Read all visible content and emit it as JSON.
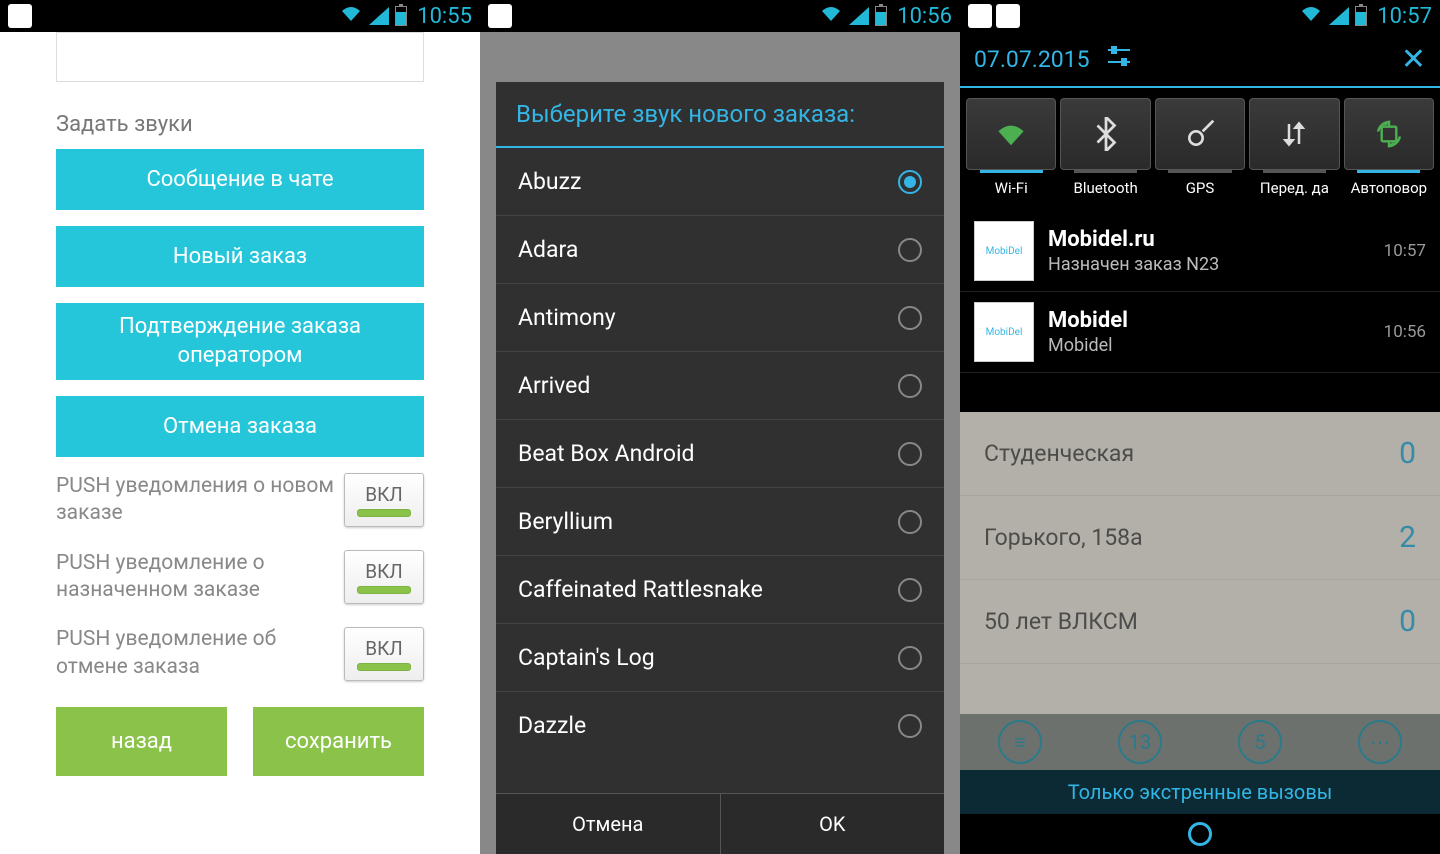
{
  "screen1": {
    "time": "10:55",
    "heading": "Задать звуки",
    "buttons": {
      "chat": "Сообщение в чате",
      "new_order": "Новый заказ",
      "confirm": "Подтверждение заказа оператором",
      "cancel": "Отмена заказа"
    },
    "push": {
      "new": "PUSH уведомления о новом заказе",
      "assigned": "PUSH уведомление о назначенном заказе",
      "cancel": "PUSH уведомление об отмене заказа",
      "toggle_label": "ВКЛ"
    },
    "footer": {
      "back": "назад",
      "save": "сохранить"
    }
  },
  "screen2": {
    "time": "10:56",
    "title": "Выберите звук нового заказа:",
    "items": [
      {
        "label": "Abuzz",
        "selected": true
      },
      {
        "label": "Adara",
        "selected": false
      },
      {
        "label": "Antimony",
        "selected": false
      },
      {
        "label": "Arrived",
        "selected": false
      },
      {
        "label": "Beat Box Android",
        "selected": false
      },
      {
        "label": "Beryllium",
        "selected": false
      },
      {
        "label": "Caffeinated Rattlesnake",
        "selected": false
      },
      {
        "label": "Captain's Log",
        "selected": false
      },
      {
        "label": "Dazzle",
        "selected": false
      }
    ],
    "footer": {
      "cancel": "Отмена",
      "ok": "OK"
    }
  },
  "screen3": {
    "time": "10:57",
    "date": "07.07.2015",
    "toggles": [
      {
        "label": "Wi-Fi",
        "active": true,
        "glyph": "wifi",
        "color": "green"
      },
      {
        "label": "Bluetooth",
        "active": false,
        "glyph": "bluetooth",
        "color": "white"
      },
      {
        "label": "GPS",
        "active": false,
        "glyph": "gps",
        "color": "white"
      },
      {
        "label": "Перед. да",
        "active": false,
        "glyph": "data",
        "color": "white"
      },
      {
        "label": "Автоповор",
        "active": true,
        "glyph": "rotate",
        "color": "green"
      }
    ],
    "notifications": [
      {
        "title": "Mobidel.ru",
        "sub": "Назначен заказ N23",
        "time": "10:57"
      },
      {
        "title": "Mobidel",
        "sub": "Mobidel",
        "time": "10:56"
      }
    ],
    "bg_rows": [
      {
        "label": "Студенческая",
        "num": "0"
      },
      {
        "label": "Горького, 158а",
        "num": "2"
      },
      {
        "label": "50 лет ВЛКСМ",
        "num": "0"
      }
    ],
    "circle_numbers": [
      "",
      "13",
      "5",
      ""
    ],
    "emergency": "Только экстренные вызовы"
  }
}
